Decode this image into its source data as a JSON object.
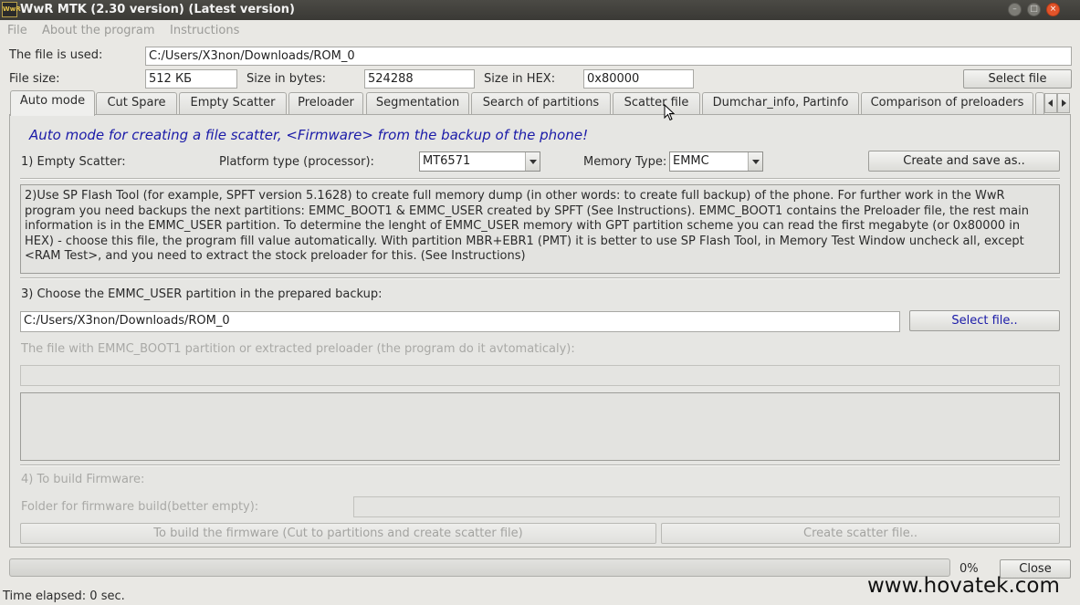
{
  "window": {
    "icon_text": "WwR",
    "title": "WwR MTK (2.30 version) (Latest version)"
  },
  "menu": [
    "File",
    "About the program",
    "Instructions"
  ],
  "file_info": {
    "used_label": "The file is used:",
    "used_value": "C:/Users/X3non/Downloads/ROM_0",
    "size_label": "File size:",
    "size_value": "512 КБ",
    "bytes_label": "Size in bytes:",
    "bytes_value": "524288",
    "hex_label": "Size in HEX:",
    "hex_value": "0x80000",
    "select_button": "Select file"
  },
  "tabs": [
    "Auto mode",
    "Cut Spare",
    "Empty Scatter",
    "Preloader",
    "Segmentation",
    "Search of partitions",
    "Scatter file",
    "Dumchar_info, Partinfo",
    "Comparison of preloaders"
  ],
  "auto_mode": {
    "heading": "Auto mode for creating a file scatter, <Firmware> from the backup of the phone!",
    "step1_label": "1) Empty Scatter:",
    "platform_label": "Platform type (processor):",
    "platform_value": "MT6571",
    "memory_label": "Memory Type:",
    "memory_value": "EMMC",
    "create_save_button": "Create and save as..",
    "info_lines": [
      "2)Use SP Flash Tool (for example, SPFT version 5.1628) to create full memory dump (in other words: to create full backup) of the phone. For further work in the WwR",
      "program you need backups the next partitions: EMMC_BOOT1 & EMMC_USER created by SPFT (See Instructions). EMMC_BOOT1 contains the Preloader file, the rest main",
      "information is in the EMMC_USER partition. To determine the lenght of EMMC_USER memory with GPT partition scheme you can read the first megabyte (or 0x80000 in",
      "HEX) - choose this file, the program fill value automatically. With partition MBR+EBR1 (PMT) it is better to use SP Flash Tool, in Memory Test Window uncheck all, except",
      "<RAM Test>, and you need to extract the stock preloader for this. (See Instructions)"
    ],
    "step3_label": "3) Choose the EMMC_USER partition in the prepared backup:",
    "emmc_user_path": "C:/Users/X3non/Downloads/ROM_0",
    "select_file_button": "Select file..",
    "boot1_label": "The file with EMMC_BOOT1 partition or extracted preloader (the program do it avtomaticaly):",
    "boot1_path": "",
    "step4_label": "4) To build Firmware:",
    "folder_label": "Folder for firmware build(better empty):",
    "folder_path": "",
    "build_button": "To build the firmware (Cut to partitions and create scatter file)",
    "create_scatter_button": "Create scatter file.."
  },
  "footer": {
    "progress_percent": "0%",
    "progress_value": 0,
    "close_button": "Close",
    "elapsed_label": "Time elapsed: 0  sec.",
    "watermark": "www.hovatek.com"
  }
}
